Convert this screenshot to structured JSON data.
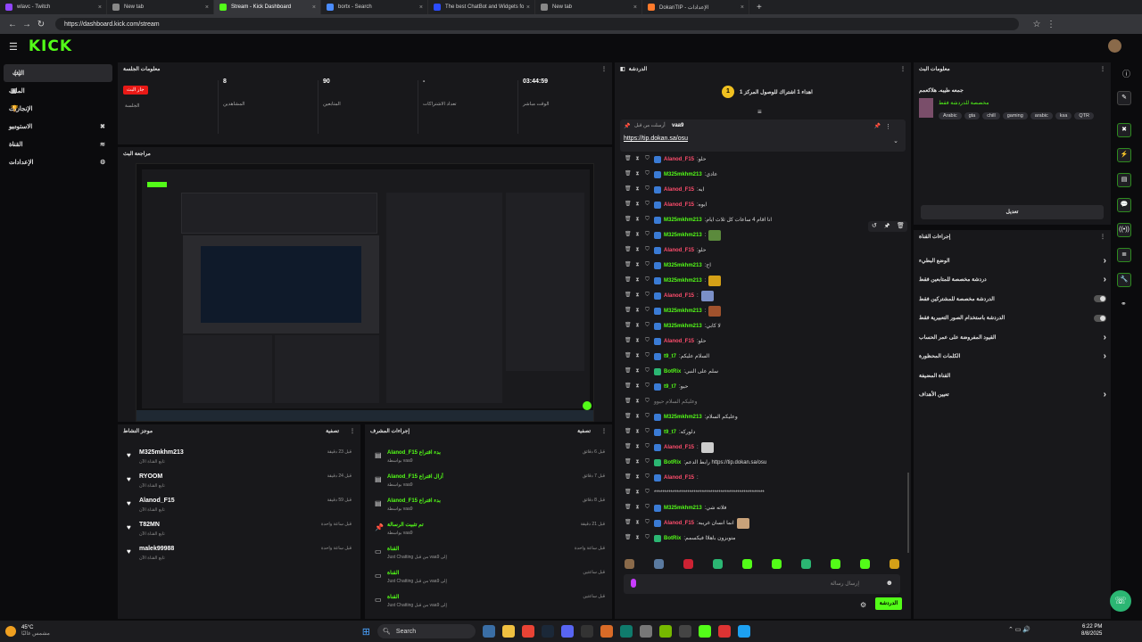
{
  "browser": {
    "tabs": [
      {
        "label": "wlavc - Twitch",
        "fav": "#9146ff"
      },
      {
        "label": "New tab",
        "fav": "#888888"
      },
      {
        "label": "Stream - Kick Dashboard",
        "fav": "#53fc18",
        "active": true
      },
      {
        "label": "bortx - Search",
        "fav": "#4a8cff"
      },
      {
        "label": "The best ChatBot and Widgets fo",
        "fav": "#2b4cff"
      },
      {
        "label": "New tab",
        "fav": "#888888"
      },
      {
        "label": "DokanTIP - الإعدادات",
        "fav": "#ff7a2b"
      }
    ],
    "url": "https://dashboard.kick.com/stream"
  },
  "header": {
    "logo": "KICK"
  },
  "sidebar": {
    "items": [
      {
        "label": "البث",
        "icon": "(•)",
        "active": true
      },
      {
        "label": "الملف",
        "icon": "▣"
      },
      {
        "label": "الإنجازات",
        "icon": "🏆"
      },
      {
        "label": "الاستوديو",
        "icon": "⌄",
        "icon2": "✖"
      },
      {
        "label": "القناة",
        "icon": "⌄",
        "icon2": "≋"
      },
      {
        "label": "الإعدادات",
        "icon": "⌄",
        "icon2": "⚙"
      }
    ]
  },
  "session": {
    "title": "معلومات الجلسة",
    "live_badge": "جار البث",
    "live_label": "الجلسة",
    "stats": [
      {
        "value": "8",
        "label": "المشاهدين"
      },
      {
        "value": "90",
        "label": "المتابعين"
      },
      {
        "value": "-",
        "label": "تعداد الاشتراكات"
      },
      {
        "value": "03:44:59",
        "label": "الوقت مباشر"
      }
    ]
  },
  "preview": {
    "title": "مراجعة البث"
  },
  "activity": {
    "title": "موجز النشاط",
    "filter": "تصفية",
    "items": [
      {
        "name": "M325mkhm213",
        "sub": "تابع القناة الآن",
        "time": "قبل 23 دقيقة"
      },
      {
        "name": "RYOOM",
        "sub": "تابع القناة الآن",
        "time": "قبل 24 دقيقة"
      },
      {
        "name": "Alanod_F15",
        "sub": "تابع القناة الآن",
        "time": "قبل 59 دقيقة"
      },
      {
        "name": "T82MN",
        "sub": "تابع القناة الآن",
        "time": "قبل ساعة واحدة"
      },
      {
        "name": "malek99988",
        "sub": "تابع القناة الآن",
        "time": "قبل ساعة واحدة"
      }
    ]
  },
  "modlog": {
    "title": "إجراءات المشرف",
    "filter": "تصفية",
    "items": [
      {
        "t1": "Alanod_F15 بدء اقتراع",
        "t2": "بواسطة vaa9",
        "time": "قبل 6 دقائق",
        "icon": "▤"
      },
      {
        "t1": "Alanod_F15 أزال اقتراع",
        "t2": "بواسطة vaa9",
        "time": "قبل 7 دقائق",
        "icon": "▤"
      },
      {
        "t1": "Alanod_F15 بدء اقتراع",
        "t2": "بواسطة vaa9",
        "time": "قبل 8 دقائق",
        "icon": "▤"
      },
      {
        "t1": "تم تثبيت الرسالة",
        "t2": "بواسطة vaa9",
        "time": "قبل 21 دقيقة",
        "icon": "📌"
      },
      {
        "t1": "القناة",
        "t2": "Just Chatting من قبل vaa9 إلى",
        "time": "قبل ساعة واحدة",
        "icon": "▭"
      },
      {
        "t1": "القناة",
        "t2": "Just Chatting من قبل vaa9 إلى",
        "time": "قبل ساعتين",
        "icon": "▭"
      },
      {
        "t1": "القناة",
        "t2": "Just Chatting من قبل vaa9 إلى",
        "time": "قبل ساعتين",
        "icon": "▭"
      }
    ]
  },
  "chat": {
    "title": "الدردشة",
    "goal": "اهداء 1 اشتراك للوصول المركز 1",
    "pinned_by": "vaa9",
    "pinned_label": "أرسلت من قبل",
    "pinned_link": "https://tip.dokan.sa/osu",
    "messages": [
      {
        "user": "Alanod_F15",
        "color": "#ff4d6d",
        "text": "حلو",
        "emote": ""
      },
      {
        "user": "M325mkhm213",
        "color": "#53fc18",
        "text": "عادي",
        "emote": ""
      },
      {
        "user": "Alanod_F15",
        "color": "#ff4d6d",
        "text": "ايه",
        "emote": ""
      },
      {
        "user": "Alanod_F15",
        "color": "#ff4d6d",
        "text": "ايوه",
        "emote": ""
      },
      {
        "user": "M325mkhm213",
        "color": "#53fc18",
        "text": "انا اقام 4 ساعات كل ثلاث ايام",
        "emote": ""
      },
      {
        "user": "M325mkhm213",
        "color": "#53fc18",
        "text": "",
        "emote": "#5b8a3c"
      },
      {
        "user": "Alanod_F15",
        "color": "#ff4d6d",
        "text": "حلو",
        "emote": ""
      },
      {
        "user": "M325mkhm213",
        "color": "#53fc18",
        "text": "اح",
        "emote": ""
      },
      {
        "user": "M325mkhm213",
        "color": "#53fc18",
        "text": "",
        "emote": "#d4a017"
      },
      {
        "user": "Alanod_F15",
        "color": "#ff4d6d",
        "text": "",
        "emote": "#7b8fc7"
      },
      {
        "user": "M325mkhm213",
        "color": "#53fc18",
        "text": "",
        "emote": "#a0522d"
      },
      {
        "user": "M325mkhm213",
        "color": "#53fc18",
        "text": "لا كابي",
        "emote": ""
      },
      {
        "user": "Alanod_F15",
        "color": "#ff4d6d",
        "text": "حلو",
        "emote": ""
      },
      {
        "user": "t9_t7",
        "color": "#53fc18",
        "text": "السلام عليكم",
        "emote": ""
      },
      {
        "user": "BotRix",
        "color": "#53fc18",
        "text": "سلم على النبي",
        "emote": ""
      },
      {
        "user": "t9_t7",
        "color": "#53fc18",
        "text": "حيو",
        "emote": ""
      },
      {
        "user": "",
        "color": "#888888",
        "text": "وعليكم السلام حيوو",
        "emote": ""
      },
      {
        "user": "M325mkhm213",
        "color": "#53fc18",
        "text": "وعليكم السلام",
        "emote": ""
      },
      {
        "user": "t9_t7",
        "color": "#53fc18",
        "text": "دلوركه",
        "emote": ""
      },
      {
        "user": "Alanod_F15",
        "color": "#ff4d6d",
        "text": "",
        "emote": "#cccccc"
      },
      {
        "user": "BotRix",
        "color": "#53fc18",
        "text": "رابط الدعم https://tip.dokan.sa/osu",
        "emote": ""
      },
      {
        "user": "Alanod_F15",
        "color": "#ff4d6d",
        "text": "",
        "emote": ""
      },
      {
        "user": "",
        "color": "#dddddd",
        "text": "*****************************************************",
        "emote": ""
      },
      {
        "user": "M325mkhm213",
        "color": "#53fc18",
        "text": "فلاته شي",
        "emote": ""
      },
      {
        "user": "Alanod_F15",
        "color": "#ff4d6d",
        "text": "انما انسان غريبه",
        "emote": "#c9a27a"
      },
      {
        "user": "BotRix",
        "color": "#53fc18",
        "text": "متوبزون باهلاا فيكسمم",
        "emote": ""
      }
    ],
    "input_placeholder": "إرسال رسالة",
    "send": "الدردشة"
  },
  "stream_info": {
    "title": "معلومات البث",
    "stream_title": "جمعه طيبه. هلاكعمم",
    "category": "مخصصة للدردشة فقط",
    "tags": [
      "Arabic",
      "gta",
      "chill",
      "gaming",
      "arabic",
      "ksa",
      "QTR"
    ],
    "edit": "تعديل"
  },
  "channel_actions": {
    "title": "إجراءات القناة",
    "rows": [
      {
        "label": "الوضع البطيء",
        "control": "arrow"
      },
      {
        "label": "دردشة مخصصة للمتابعين فقط",
        "control": "arrow"
      },
      {
        "label": "الدردشة مخصصة للمشتركين فقط",
        "control": "toggle"
      },
      {
        "label": "الدردشة باستخدام الصور التعبيرية فقط",
        "control": "toggle"
      },
      {
        "label": "القيود المفروضة على عمر الحساب",
        "control": "arrow"
      },
      {
        "label": "الكلمات المحظورة",
        "control": "arrow"
      },
      {
        "label": "القناة المضيفة",
        "control": "none"
      },
      {
        "label": "تعيين الأهداف",
        "control": "arrow"
      }
    ]
  },
  "taskbar": {
    "weather": "45°C",
    "weather_sub": "مشمس غالبًا",
    "search": "Search",
    "time": "6:22 PM",
    "date": "8/8/2025"
  }
}
